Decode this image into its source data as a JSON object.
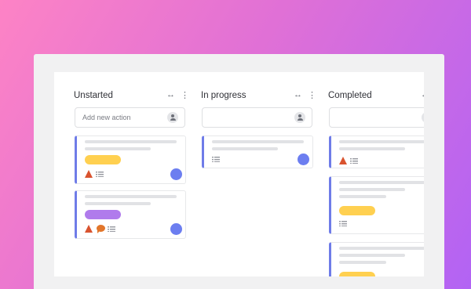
{
  "columns": [
    {
      "title": "Unstarted",
      "resize_icon": "↔",
      "more_icon": "⋮",
      "add_placeholder": "Add new action"
    },
    {
      "title": "In progress",
      "resize_icon": "↔",
      "more_icon": "⋮",
      "add_placeholder": ""
    },
    {
      "title": "Completed",
      "resize_icon": "↔",
      "more_icon": "⋮",
      "add_placeholder": ""
    }
  ],
  "icons": {
    "resize": "resize-horizontal-icon",
    "more": "more-vertical-icon",
    "assignee": "person-icon",
    "warning": "warning-icon",
    "comment": "comment-icon",
    "checklist": "checklist-icon",
    "avatar": "user-avatar"
  },
  "colors": {
    "card_accent": "#6f7ce8",
    "tag_yellow": "#ffd050",
    "tag_purple": "#b07bec",
    "warning": "#d9532f",
    "comment": "#e2762b",
    "avatar": "#6c7ef0"
  }
}
